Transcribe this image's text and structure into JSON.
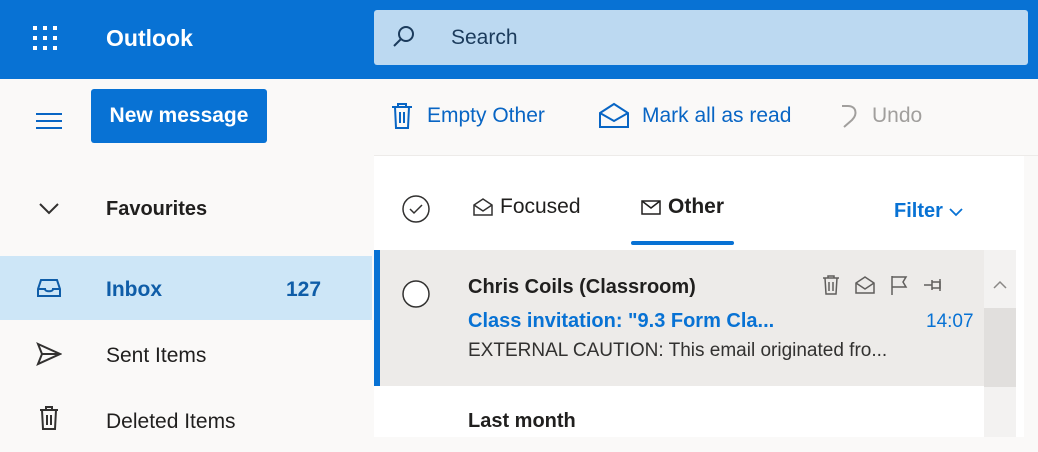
{
  "topbar": {
    "app_title": "Outlook",
    "search_placeholder": "Search",
    "color": "#0872d4"
  },
  "commands": {
    "new_message": "New message",
    "empty_other": "Empty Other",
    "mark_all_read": "Mark all as read",
    "undo": "Undo"
  },
  "nav": {
    "favourites": "Favourites",
    "items": [
      {
        "label": "Inbox",
        "count": "127",
        "icon": "inbox-icon",
        "active": true
      },
      {
        "label": "Sent Items",
        "icon": "send-icon"
      },
      {
        "label": "Deleted Items",
        "icon": "trash-icon"
      }
    ]
  },
  "list": {
    "tabs": [
      {
        "label": "Focused",
        "icon": "focused-icon"
      },
      {
        "label": "Other",
        "icon": "other-icon",
        "selected": true
      }
    ],
    "filter": "Filter",
    "messages": [
      {
        "sender": "Chris Coils (Classroom)",
        "subject": "Class invitation: \"9.3 Form Cla...",
        "time": "14:07",
        "preview": "EXTERNAL CAUTION: This email originated fro..."
      }
    ],
    "group_header": "Last month"
  }
}
